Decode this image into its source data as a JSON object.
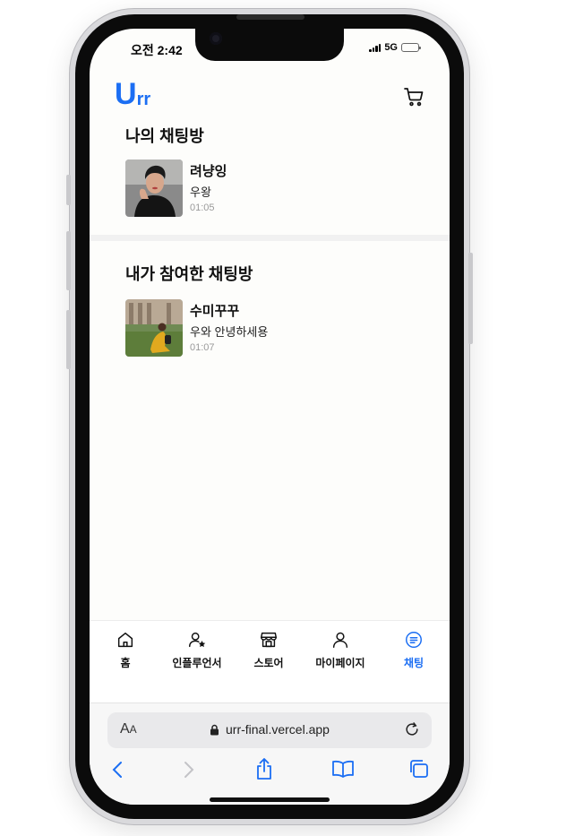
{
  "status_bar": {
    "time": "오전 2:42",
    "network": "5G"
  },
  "app": {
    "logo_big": "U",
    "logo_small": "rr"
  },
  "my_chats": {
    "title": "나의 채팅방",
    "items": [
      {
        "name": "려냥잉",
        "message": "우왕",
        "time": "01:05"
      }
    ]
  },
  "joined_chats": {
    "title": "내가 참여한 채팅방",
    "items": [
      {
        "name": "수미꾸꾸",
        "message": "우와 안녕하세용",
        "time": "01:07"
      }
    ]
  },
  "tabbar": {
    "items": [
      {
        "label": "홈",
        "icon": "home-icon"
      },
      {
        "label": "인플루언서",
        "icon": "influencer-icon"
      },
      {
        "label": "스토어",
        "icon": "store-icon"
      },
      {
        "label": "마이페이지",
        "icon": "person-icon"
      },
      {
        "label": "채팅",
        "icon": "chat-icon",
        "active": true
      }
    ]
  },
  "browser": {
    "aa": "A",
    "aa_small": "A",
    "url": "urr-final.vercel.app"
  },
  "colors": {
    "accent": "#1b6ef3",
    "background": "#fdfdfb"
  }
}
